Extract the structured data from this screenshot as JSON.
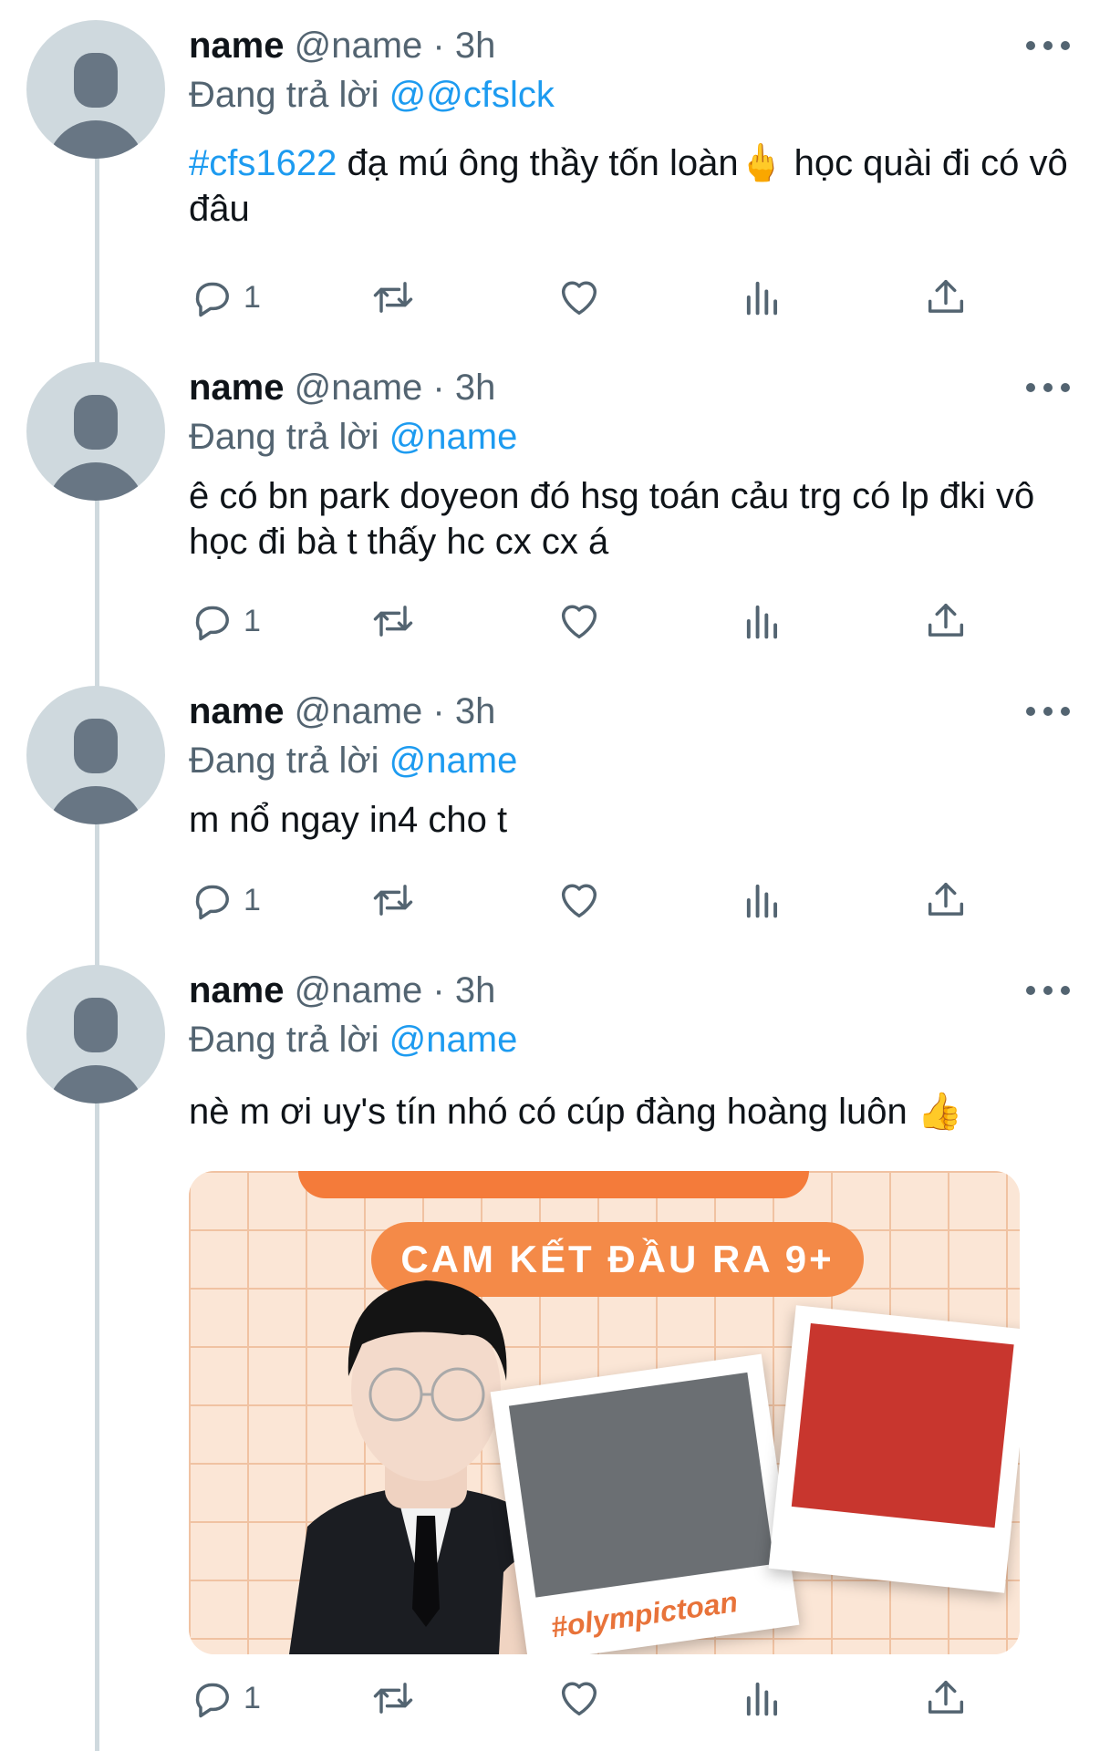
{
  "tweets": [
    {
      "display_name": "name",
      "handle": "@name",
      "separator": "·",
      "time": "3h",
      "reply_prefix": "Đang trả lời",
      "reply_to": "@@cfslck",
      "hashtag": "#cfs1622",
      "text": " đạ mú ông thầy tốn loàn🖕 học quài đi có vô đâu",
      "reply_count": "1"
    },
    {
      "display_name": "name",
      "handle": "@name",
      "separator": "·",
      "time": "3h",
      "reply_prefix": "Đang trả lời",
      "reply_to": "@name",
      "text": "ê có bn park doyeon đó hsg toán cảu trg có lp đki vô học đi bà t thấy hc cx cx á",
      "reply_count": "1"
    },
    {
      "display_name": "name",
      "handle": "@name",
      "separator": "·",
      "time": "3h",
      "reply_prefix": "Đang trả lời",
      "reply_to": "@name",
      "text": "m nổ ngay in4 cho t",
      "reply_count": "1"
    },
    {
      "display_name": "name",
      "handle": "@name",
      "separator": "·",
      "time": "3h",
      "reply_prefix": "Đang trả lời",
      "reply_to": "@name",
      "text": "nè m ơi uy's tín nhó có cúp đàng hoàng luôn 👍",
      "reply_count": "1",
      "media": {
        "banner_text": "CAM KẾT ĐẦU RA 9+",
        "polaroid_caption": "#olympictoan"
      }
    }
  ],
  "icons": {
    "reply": "reply-icon",
    "retweet": "retweet-icon",
    "like": "heart-icon",
    "views": "views-icon",
    "share": "share-icon",
    "more": "more-icon"
  },
  "colors": {
    "accent": "#1d9bf0",
    "secondary_text": "#536471",
    "thread_line": "#cfd9de"
  }
}
